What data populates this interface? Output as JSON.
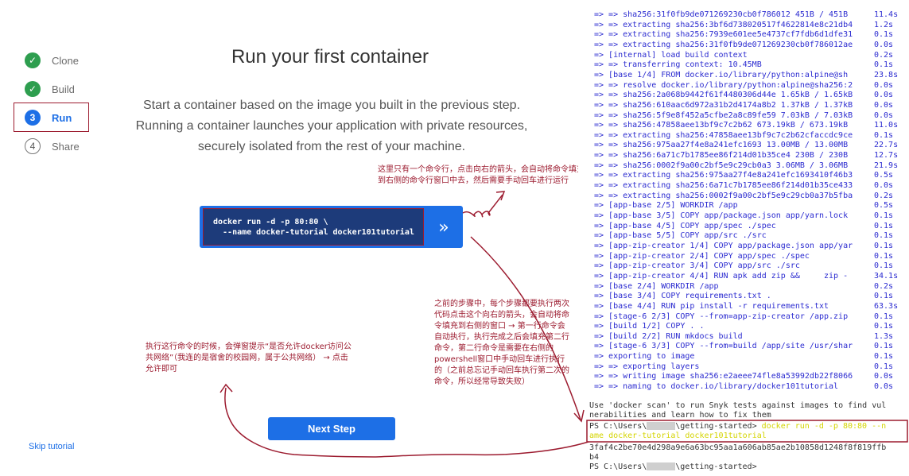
{
  "steps": [
    {
      "label": "Clone",
      "state": "done",
      "glyph": "✓"
    },
    {
      "label": "Build",
      "state": "done",
      "glyph": "✓"
    },
    {
      "label": "Run",
      "state": "current",
      "glyph": "3"
    },
    {
      "label": "Share",
      "state": "todo",
      "glyph": "4"
    }
  ],
  "main": {
    "title": "Run your first container",
    "description": "Start a container based on the image you built in the previous step. Running a container launches your application with private resources, securely isolated from the rest of your machine.",
    "command_line1": "docker run -d -p 80:80 \\",
    "command_line2": "  --name docker-tutorial docker101tutorial",
    "run_icon": "»",
    "next_button": "Next Step",
    "skip_link": "Skip tutorial"
  },
  "annotations": {
    "note1": "这里只有一个命令行，点击向右的箭头，会自动将命令填充到右侧的命令行窗口中去，然后需要手动回车进行运行",
    "note2": "之前的步骤中，每个步骤都要执行两次代码点击这个向右的箭头，会自动将命令填充到右侧的窗口 → 第一行命令会自动执行，执行完成之后会填充第二行命令，第二行命令是需要在右侧的powershell窗口中手动回车进行执行的（之前总忘记手动回车执行第二次的命令，所以经常导致失败）",
    "note3": "执行这行命令的时候，会弹窗提示“是否允许docker访问公共网络”（我连的是宿舍的校园网，属于公共网络） → 点击允许即可"
  },
  "terminal": {
    "lines": [
      [
        "=> => sha256:31f0fb9de071269230cb0f786012 451B / 451B",
        "11.4s"
      ],
      [
        "=> => extracting sha256:3bf6d738020517f4622814e8c21db4",
        "1.2s"
      ],
      [
        "=> => extracting sha256:7939e601ee5e4737cf7fdb6d1dfe31",
        "0.1s"
      ],
      [
        "=> => extracting sha256:31f0fb9de071269230cb0f786012ae",
        "0.0s"
      ],
      [
        "=> [internal] load build context",
        "0.2s"
      ],
      [
        "=> => transferring context: 10.45MB",
        "0.1s"
      ],
      [
        "=> [base 1/4] FROM docker.io/library/python:alpine@sh",
        "23.8s"
      ],
      [
        "=> => resolve docker.io/library/python:alpine@sha256:2",
        "0.0s"
      ],
      [
        "=> => sha256:2a068b9442f61f4480306d44e 1.65kB / 1.65kB",
        "0.0s"
      ],
      [
        "=> => sha256:610aac6d972a31b2d4174a8b2 1.37kB / 1.37kB",
        "0.0s"
      ],
      [
        "=> => sha256:5f9e8f452a5cfbe2a8c89fe59 7.03kB / 7.03kB",
        "0.0s"
      ],
      [
        "=> => sha256:47858aee13bf9c7c2b62 673.19kB / 673.19kB",
        "11.0s"
      ],
      [
        "=> => extracting sha256:47858aee13bf9c7c2b62cfaccdc9ce",
        "0.1s"
      ],
      [
        "=> => sha256:975aa27f4e8a241efc1693 13.00MB / 13.00MB",
        "22.7s"
      ],
      [
        "=> => sha256:6a71c7b1785ee86f214d01b35ce4 230B / 230B",
        "12.7s"
      ],
      [
        "=> => sha256:0002f9a00c2bf5e9c29cb0a3 3.06MB / 3.06MB",
        "21.9s"
      ],
      [
        "=> => extracting sha256:975aa27f4e8a241efc1693410f46b3",
        "0.5s"
      ],
      [
        "=> => extracting sha256:6a71c7b1785ee86f214d01b35ce433",
        "0.0s"
      ],
      [
        "=> => extracting sha256:0002f9a00c2bf5e9c29cb0a37b5fba",
        "0.2s"
      ],
      [
        "=> [app-base 2/5] WORKDIR /app",
        "0.5s"
      ],
      [
        "=> [app-base 3/5] COPY app/package.json app/yarn.lock",
        "0.1s"
      ],
      [
        "=> [app-base 4/5] COPY app/spec ./spec",
        "0.1s"
      ],
      [
        "=> [app-base 5/5] COPY app/src ./src",
        "0.1s"
      ],
      [
        "=> [app-zip-creator 1/4] COPY app/package.json app/yar",
        "0.1s"
      ],
      [
        "=> [app-zip-creator 2/4] COPY app/spec ./spec",
        "0.1s"
      ],
      [
        "=> [app-zip-creator 3/4] COPY app/src ./src",
        "0.1s"
      ],
      [
        "=> [app-zip-creator 4/4] RUN apk add zip &&     zip -",
        "34.1s"
      ],
      [
        "=> [base 2/4] WORKDIR /app",
        "0.2s"
      ],
      [
        "=> [base 3/4] COPY requirements.txt .",
        "0.1s"
      ],
      [
        "=> [base 4/4] RUN pip install -r requirements.txt",
        "63.3s"
      ],
      [
        "=> [stage-6 2/3] COPY --from=app-zip-creator /app.zip",
        "0.1s"
      ],
      [
        "=> [build 1/2] COPY . .",
        "0.1s"
      ],
      [
        "=> [build 2/2] RUN mkdocs build",
        "1.3s"
      ],
      [
        "=> [stage-6 3/3] COPY --from=build /app/site /usr/shar",
        "0.1s"
      ],
      [
        "=> exporting to image",
        "0.1s"
      ],
      [
        "=> => exporting layers",
        "0.1s"
      ],
      [
        "=> => writing image sha256:e2aeee74fle8a53992db22f8066",
        "0.0s"
      ],
      [
        "=> => naming to docker.io/library/docker101tutorial",
        "0.0s"
      ]
    ],
    "scan_line1": "Use 'docker scan' to run Snyk tests against images to find vul",
    "scan_line2": "nerabilities and learn how to fix them",
    "ps_prefix1": "PS C:\\Users\\",
    "ps_path1": "\\getting-started> ",
    "ps_cmd1": "docker run -d -p 80:80 --n",
    "ps_cmd2": "ame docker-tutorial docker101tutorial",
    "container_id1": "3faf4c2be70e4d298a9e6a63bc95aa1a606ab85ae2b10858d1248f8f819ffb",
    "container_id2": "b4",
    "ps_prefix2": "PS C:\\Users\\",
    "ps_path2": "\\getting-started>"
  },
  "colors": {
    "accent": "#1d6fe6",
    "success": "#2e9e4f",
    "annotation": "#9c1b2f",
    "terminal_text": "#2b2bd0"
  }
}
